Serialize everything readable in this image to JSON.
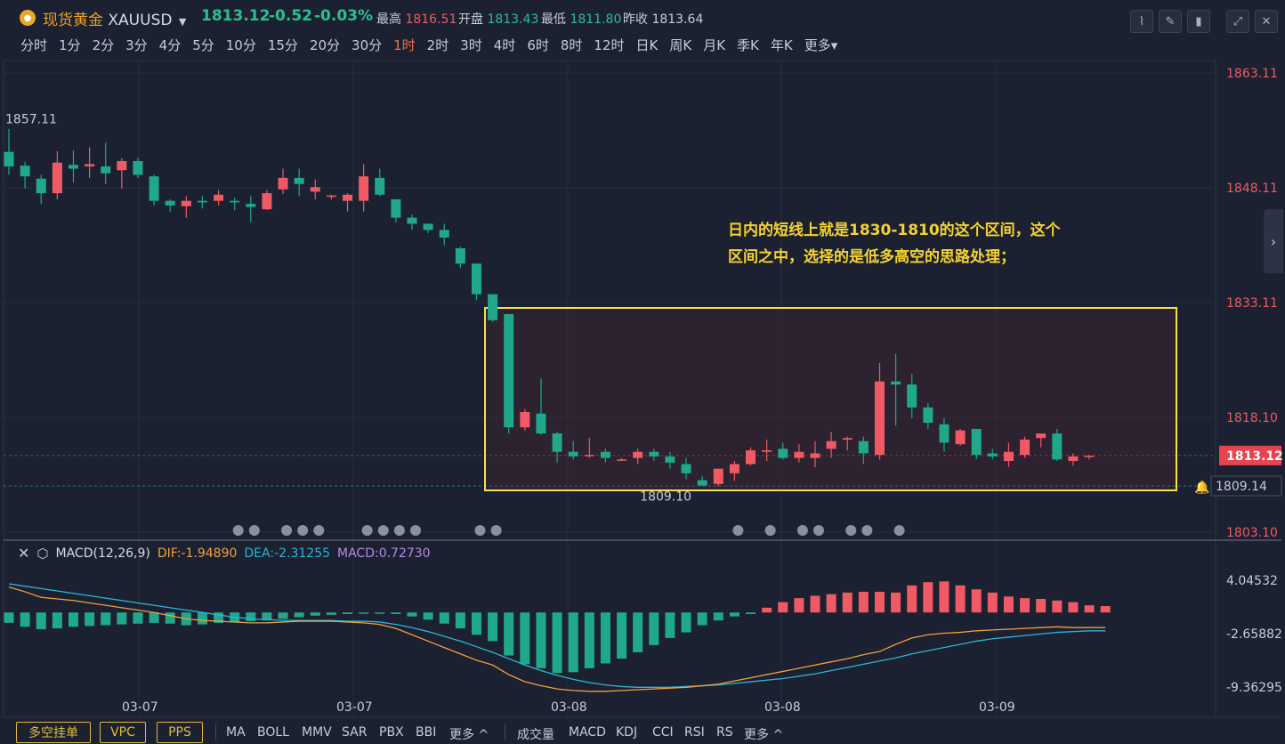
{
  "header": {
    "name": "现货黄金",
    "symbol": "XAUUSD",
    "price": "1813.12",
    "change": "-0.52",
    "change_pct": "-0.03%",
    "high_label": "最高",
    "high": "1816.51",
    "open_label": "开盘",
    "open": "1813.43",
    "low_label": "最低",
    "low": "1811.80",
    "prev_label": "昨收",
    "prev": "1813.64"
  },
  "periods": [
    "分时",
    "1分",
    "2分",
    "3分",
    "4分",
    "5分",
    "10分",
    "15分",
    "20分",
    "30分",
    "1时",
    "2时",
    "3时",
    "4时",
    "6时",
    "8时",
    "12时",
    "日K",
    "周K",
    "月K",
    "季K",
    "年K",
    "更多"
  ],
  "active_period": "1时",
  "annotation": "日内的短线上就是1830-1810的这个区间，这个区间之中，选择的是低多高空的思路处理；",
  "macd": {
    "label": "MACD(12,26,9)",
    "dif": "DIF:-1.94890",
    "dea": "DEA:-2.31255",
    "macd": "MACD:0.72730"
  },
  "bottom": {
    "pills": [
      "多空挂单",
      "VPC",
      "PPS"
    ],
    "main_indicators": [
      "MA",
      "BOLL",
      "MMV",
      "SAR",
      "PBX",
      "BBI",
      "更多 ^"
    ],
    "sub_indicators": [
      "成交量",
      "MACD",
      "KDJ",
      "CCI",
      "RSI",
      "RS",
      "更多 ^"
    ]
  },
  "colors": {
    "up": "#ef5a64",
    "down": "#1fa98a",
    "dif": "#f0a040",
    "dea": "#2bb6d6",
    "box": "#f5e04a"
  },
  "chart_data": [
    {
      "type": "candlestick",
      "ylim": [
        1803.1,
        1863.11
      ],
      "y_ticks": [
        "1863.11",
        "1848.11",
        "1833.11",
        "1818.10",
        "1803.10"
      ],
      "x_ticks": [
        "03-07",
        "03-07",
        "03-08",
        "03-08",
        "03-09"
      ],
      "current_price_label": "1813.12",
      "alert_price_label": "1809.14",
      "max_label": "1857.11",
      "min_label": "1809.10",
      "range_box": [
        1830,
        1810
      ],
      "ohlc": [
        [
          1852.8,
          1855.8,
          1849.8,
          1850.9
        ],
        [
          1851.0,
          1851.5,
          1848.0,
          1849.6
        ],
        [
          1849.3,
          1849.8,
          1846.0,
          1847.4
        ],
        [
          1847.4,
          1852.9,
          1846.6,
          1851.4
        ],
        [
          1851.1,
          1853.0,
          1848.8,
          1850.6
        ],
        [
          1850.9,
          1853.4,
          1849.4,
          1851.2
        ],
        [
          1850.9,
          1854.0,
          1848.6,
          1850.0
        ],
        [
          1850.4,
          1852.0,
          1848.0,
          1851.6
        ],
        [
          1851.6,
          1852.0,
          1849.4,
          1849.8
        ],
        [
          1849.6,
          1849.8,
          1845.8,
          1846.4
        ],
        [
          1846.4,
          1846.6,
          1845.0,
          1845.8
        ],
        [
          1845.7,
          1847.0,
          1844.2,
          1846.4
        ],
        [
          1846.4,
          1847.0,
          1845.4,
          1846.2
        ],
        [
          1846.4,
          1847.8,
          1845.8,
          1847.2
        ],
        [
          1846.4,
          1846.8,
          1845.2,
          1846.2
        ],
        [
          1846.0,
          1847.0,
          1843.6,
          1845.6
        ],
        [
          1845.3,
          1847.8,
          1845.2,
          1847.4
        ],
        [
          1847.9,
          1850.6,
          1847.3,
          1849.4
        ],
        [
          1849.4,
          1850.6,
          1847.0,
          1848.6
        ],
        [
          1847.6,
          1849.2,
          1846.6,
          1848.2
        ],
        [
          1847.0,
          1847.2,
          1846.6,
          1847.1
        ],
        [
          1846.4,
          1847.4,
          1845.0,
          1847.2
        ],
        [
          1846.4,
          1851.2,
          1845.0,
          1849.6
        ],
        [
          1849.4,
          1850.6,
          1847.0,
          1847.2
        ],
        [
          1846.6,
          1846.6,
          1843.6,
          1844.2
        ],
        [
          1844.2,
          1844.6,
          1842.6,
          1843.4
        ],
        [
          1843.4,
          1843.4,
          1842.2,
          1842.6
        ],
        [
          1842.6,
          1843.4,
          1840.6,
          1841.6
        ],
        [
          1840.2,
          1840.4,
          1837.6,
          1838.2
        ],
        [
          1838.2,
          1838.2,
          1833.4,
          1834.2
        ],
        [
          1834.2,
          1834.2,
          1830.6,
          1830.8
        ],
        [
          1831.6,
          1831.6,
          1816.0,
          1816.8
        ],
        [
          1816.8,
          1819.2,
          1816.4,
          1818.8
        ],
        [
          1818.6,
          1823.2,
          1815.8,
          1816.0
        ],
        [
          1816.0,
          1816.2,
          1812.2,
          1813.6
        ],
        [
          1813.6,
          1815.0,
          1812.6,
          1813.0
        ],
        [
          1813.2,
          1815.4,
          1812.8,
          1813.2
        ],
        [
          1813.6,
          1814.0,
          1812.2,
          1812.8
        ],
        [
          1812.6,
          1812.8,
          1812.4,
          1812.6
        ],
        [
          1812.8,
          1814.0,
          1812.0,
          1813.6
        ],
        [
          1813.6,
          1814.0,
          1812.4,
          1813.0
        ],
        [
          1813.0,
          1813.6,
          1811.4,
          1812.2
        ],
        [
          1812.0,
          1812.8,
          1810.0,
          1810.8
        ],
        [
          1809.9,
          1810.4,
          1809.1,
          1809.2
        ],
        [
          1809.4,
          1811.4,
          1809.1,
          1811.4
        ],
        [
          1810.8,
          1812.4,
          1809.8,
          1812.0
        ],
        [
          1812.0,
          1814.2,
          1811.8,
          1813.8
        ],
        [
          1813.6,
          1815.2,
          1812.4,
          1813.8
        ],
        [
          1814.0,
          1814.8,
          1812.6,
          1812.8
        ],
        [
          1812.8,
          1814.6,
          1812.2,
          1813.6
        ],
        [
          1812.8,
          1815.0,
          1811.6,
          1813.4
        ],
        [
          1814.0,
          1816.2,
          1812.8,
          1815.0
        ],
        [
          1815.2,
          1815.6,
          1813.8,
          1815.4
        ],
        [
          1815.0,
          1815.6,
          1812.0,
          1813.4
        ],
        [
          1813.2,
          1825.2,
          1812.6,
          1822.8
        ],
        [
          1822.8,
          1826.4,
          1817.0,
          1822.4
        ],
        [
          1822.4,
          1823.8,
          1818.0,
          1819.4
        ],
        [
          1819.4,
          1820.0,
          1816.6,
          1817.4
        ],
        [
          1817.2,
          1818.0,
          1813.6,
          1814.8
        ],
        [
          1814.6,
          1816.6,
          1814.4,
          1816.4
        ],
        [
          1816.6,
          1816.6,
          1812.6,
          1813.2
        ],
        [
          1813.4,
          1814.0,
          1812.6,
          1813.0
        ],
        [
          1812.4,
          1814.8,
          1811.6,
          1813.6
        ],
        [
          1813.2,
          1815.6,
          1812.8,
          1815.2
        ],
        [
          1815.4,
          1816.0,
          1814.2,
          1816.0
        ],
        [
          1816.0,
          1816.6,
          1812.4,
          1812.6
        ],
        [
          1812.4,
          1813.4,
          1811.8,
          1813.0
        ],
        [
          1813.0,
          1813.2,
          1812.6,
          1813.1
        ]
      ]
    },
    {
      "type": "bar+line",
      "title": "MACD(12,26,9)",
      "ylim": [
        -10.5,
        6.0
      ],
      "y_ticks": [
        "4.04532",
        "-2.65882",
        "-9.36295"
      ],
      "hist": [
        -1.3,
        -1.8,
        -2.1,
        -2.0,
        -1.8,
        -1.7,
        -1.6,
        -1.5,
        -1.4,
        -1.3,
        -1.4,
        -1.6,
        -1.5,
        -1.3,
        -1.2,
        -1.1,
        -1.0,
        -0.8,
        -0.6,
        -0.4,
        -0.3,
        -0.2,
        -0.15,
        -0.1,
        -0.2,
        -0.5,
        -0.9,
        -1.4,
        -2.0,
        -2.8,
        -3.6,
        -5.4,
        -6.5,
        -7.0,
        -7.6,
        -7.5,
        -7.0,
        -6.4,
        -5.8,
        -5.0,
        -4.1,
        -3.2,
        -2.5,
        -1.6,
        -1.0,
        -0.5,
        -0.2,
        0.6,
        1.3,
        1.8,
        2.1,
        2.3,
        2.5,
        2.6,
        2.6,
        2.5,
        3.4,
        3.8,
        3.9,
        3.4,
        2.9,
        2.5,
        2.0,
        1.8,
        1.7,
        1.5,
        1.3,
        0.9,
        0.8
      ],
      "dif": [
        3.2,
        2.6,
        1.9,
        1.7,
        1.5,
        1.2,
        0.9,
        0.6,
        0.3,
        0.0,
        -0.4,
        -0.8,
        -1.0,
        -1.1,
        -1.2,
        -1.3,
        -1.3,
        -1.2,
        -1.1,
        -1.1,
        -1.1,
        -1.2,
        -1.3,
        -1.5,
        -2.0,
        -2.8,
        -3.6,
        -4.4,
        -5.2,
        -6.0,
        -6.6,
        -7.8,
        -8.7,
        -9.2,
        -9.6,
        -9.8,
        -9.9,
        -9.9,
        -9.8,
        -9.7,
        -9.6,
        -9.5,
        -9.4,
        -9.2,
        -9.0,
        -8.6,
        -8.2,
        -7.8,
        -7.4,
        -7.0,
        -6.6,
        -6.2,
        -5.8,
        -5.3,
        -4.9,
        -4.0,
        -3.2,
        -2.8,
        -2.6,
        -2.5,
        -2.3,
        -2.2,
        -2.1,
        -2.0,
        -1.9,
        -1.8,
        -1.9,
        -1.9,
        -1.9
      ],
      "dea": [
        3.6,
        3.3,
        3.0,
        2.7,
        2.4,
        2.1,
        1.8,
        1.5,
        1.2,
        0.9,
        0.6,
        0.3,
        0.0,
        -0.3,
        -0.6,
        -0.8,
        -0.9,
        -1.0,
        -1.0,
        -1.0,
        -1.0,
        -1.1,
        -1.1,
        -1.2,
        -1.5,
        -1.9,
        -2.4,
        -3.0,
        -3.6,
        -4.3,
        -5.0,
        -5.8,
        -6.6,
        -7.3,
        -7.9,
        -8.4,
        -8.8,
        -9.1,
        -9.3,
        -9.4,
        -9.4,
        -9.4,
        -9.3,
        -9.2,
        -9.1,
        -8.9,
        -8.7,
        -8.5,
        -8.3,
        -8.0,
        -7.7,
        -7.3,
        -6.9,
        -6.5,
        -6.1,
        -5.7,
        -5.2,
        -4.8,
        -4.4,
        -4.0,
        -3.6,
        -3.3,
        -3.1,
        -2.9,
        -2.7,
        -2.5,
        -2.4,
        -2.3,
        -2.3
      ]
    }
  ]
}
